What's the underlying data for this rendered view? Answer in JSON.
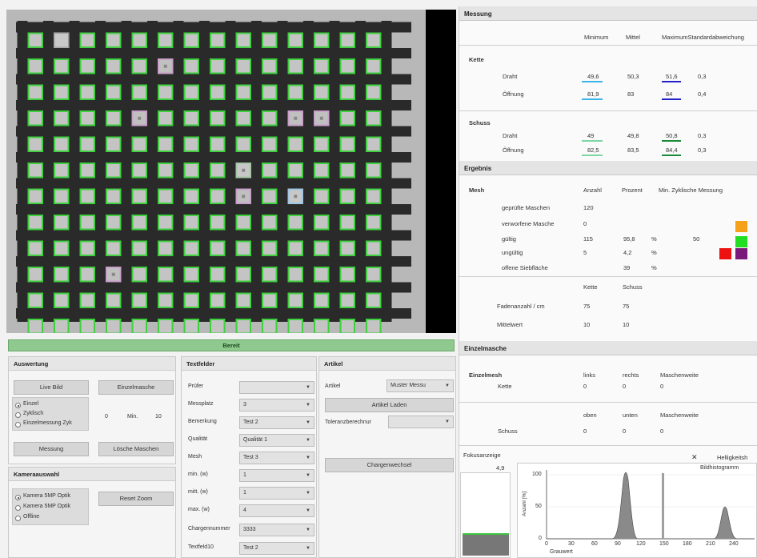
{
  "measurement": {
    "header": "Messung",
    "cols": [
      "Minimum",
      "Mittel",
      "MaximumStandardabweichung"
    ],
    "kette": {
      "label": "Kette",
      "rows": [
        {
          "label": "Draht",
          "min": "49,6",
          "mittel": "50,3",
          "max": "51,6",
          "std": "0,3"
        },
        {
          "label": "Öffnung",
          "min": "81,9",
          "mittel": "83",
          "max": "84",
          "std": "0,4"
        }
      ]
    },
    "schuss": {
      "label": "Schuss",
      "rows": [
        {
          "label": "Draht",
          "min": "49",
          "mittel": "49,8",
          "max": "50,8",
          "std": "0,3"
        },
        {
          "label": "Öffnung",
          "min": "82,5",
          "mittel": "83,5",
          "max": "84,4",
          "std": "0,3"
        }
      ]
    }
  },
  "result": {
    "header": "Ergebnis",
    "mesh_label": "Mesh",
    "cols": [
      "Anzahl",
      "Prozent",
      "Min. Zyklische Messung"
    ],
    "rows": [
      {
        "label": "geprüfte Maschen",
        "anzahl": "120",
        "prozent": "",
        "unit": "",
        "extra": ""
      },
      {
        "label": "verworfene Masche",
        "anzahl": "0",
        "prozent": "",
        "unit": "",
        "extra": ""
      },
      {
        "label": "gültig",
        "anzahl": "115",
        "prozent": "95,8",
        "unit": "%",
        "extra": "50"
      },
      {
        "label": "ungültig",
        "anzahl": "5",
        "prozent": "4,2",
        "unit": "%",
        "extra": ""
      },
      {
        "label": "offene Siebfläche",
        "anzahl": "",
        "prozent": "39",
        "unit": "%",
        "extra": ""
      }
    ],
    "thread_cols": [
      "Kette",
      "Schuss"
    ],
    "thread_rows": [
      {
        "label": "Fadenanzahl / cm",
        "kette": "75",
        "schuss": "75"
      },
      {
        "label": "Mittelwert",
        "kette": "10",
        "schuss": "10"
      }
    ],
    "colors": {
      "orange": "#f5a21a",
      "green": "#22dd22",
      "red": "#ee1111",
      "purple": "#7a1a7a"
    }
  },
  "single_mesh": {
    "header": "Einzelmasche",
    "label": "Einzelmesh",
    "cols1": [
      "links",
      "rechts",
      "Maschenweite"
    ],
    "kette_label": "Kette",
    "kette_vals": [
      "0",
      "0",
      "0"
    ],
    "cols2": [
      "oben",
      "unten",
      "Maschenweite"
    ],
    "schuss_label": "Schuss",
    "schuss_vals": [
      "0",
      "0",
      "0"
    ]
  },
  "focus": {
    "label": "Fokusanzeige",
    "value": "4,9",
    "level": 0.27
  },
  "histogram": {
    "close": "✕",
    "title": "Helligkeitsh",
    "subtitle": "Bildhistogramm",
    "ylabel": "Anzahl [%]",
    "xlabel": "Grauwert",
    "yticks": [
      "100",
      "50",
      "0"
    ],
    "xticks": [
      "0",
      "30",
      "60",
      "90",
      "120",
      "150",
      "180",
      "210",
      "240"
    ]
  },
  "status": "Bereit",
  "auswertung": {
    "header": "Auswertung",
    "live_btn": "Live Bild",
    "einzel_btn": "Einzelmasche",
    "radios": [
      "Einzel",
      "Zyklisch",
      "Einzelmessung Zyk"
    ],
    "interval_value": "0",
    "min_label": "Min.",
    "min_value": "10",
    "messung_btn": "Messung",
    "loesche_btn": "Lösche Maschen"
  },
  "kamera": {
    "header": "Kameraauswahl",
    "radios": [
      "Kamera 5MP Optik",
      "Kamera 5MP Optik",
      "Offline"
    ],
    "reset_btn": "Reset Zoom"
  },
  "textfelder": {
    "header": "Textfelder",
    "fields": [
      {
        "label": "Prüfer",
        "value": ""
      },
      {
        "label": "Messplatz",
        "value": "3"
      },
      {
        "label": "Bemerkung",
        "value": "Test 2"
      },
      {
        "label": "Qualität",
        "value": "Qualität 1"
      },
      {
        "label": "Mesh",
        "value": "Test 3"
      },
      {
        "label": "min. (w)",
        "value": "1"
      },
      {
        "label": "mitt. (w)",
        "value": "1"
      },
      {
        "label": "max. (w)",
        "value": "4"
      },
      {
        "label": "Chargennummer",
        "value": "3333"
      },
      {
        "label": "Textfeld10",
        "value": "Test 2"
      }
    ]
  },
  "artikel": {
    "header": "Artikel",
    "artikel_label": "Artikel",
    "artikel_value": "Muster Messu",
    "laden_btn": "Artikel Laden",
    "toleranz_label": "Toleranzberechnur",
    "toleranz_value": "",
    "charge_btn": "Chargenwechsel"
  }
}
